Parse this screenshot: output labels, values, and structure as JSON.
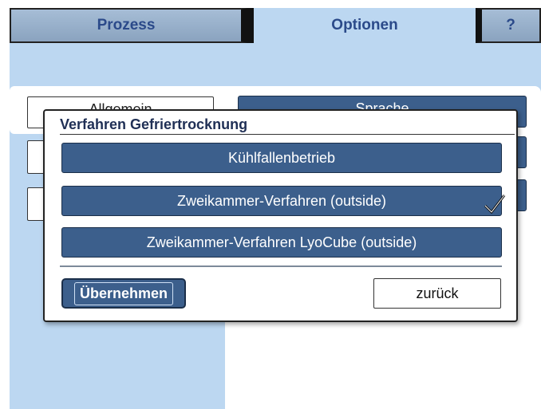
{
  "tabs": {
    "prozess": "Prozess",
    "optionen": "Optionen",
    "help": "?"
  },
  "background": {
    "left_button_partial": "Allgemein",
    "right_button_partial": "Sprache"
  },
  "dialog": {
    "title": "Verfahren Gefriertrocknung",
    "options": [
      {
        "label": "Kühlfallenbetrieb",
        "selected": false
      },
      {
        "label": "Zweikammer-Verfahren (outside)",
        "selected": true
      },
      {
        "label": "Zweikammer-Verfahren LyoCube (outside)",
        "selected": false
      }
    ],
    "apply_label": "Übernehmen",
    "back_label": "zurück"
  },
  "icons": {
    "selected": "checkmark-icon"
  },
  "colors": {
    "screen_bg": "#bcd7f1",
    "button_blue": "#3c5f8c",
    "tab_text": "#2b4a8a"
  }
}
